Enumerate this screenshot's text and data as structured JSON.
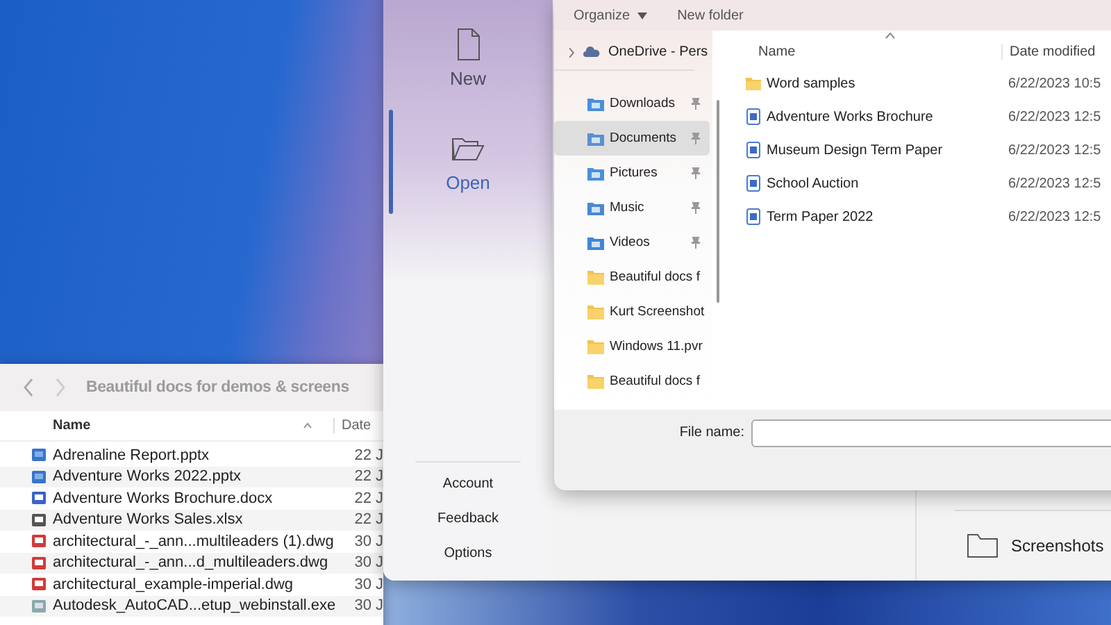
{
  "finder": {
    "path": "Beautiful docs for demos & screens",
    "columns": [
      "Name",
      "Date"
    ],
    "rows": [
      {
        "name": "Adrenaline Report.pptx",
        "date": "22 J",
        "kind": "slides"
      },
      {
        "name": "Adventure Works 2022.pptx",
        "date": "22 J",
        "kind": "slides"
      },
      {
        "name": "Adventure Works Brochure.docx",
        "date": "22 J",
        "kind": "doc"
      },
      {
        "name": "Adventure Works Sales.xlsx",
        "date": "22 J",
        "kind": "sheet"
      },
      {
        "name": "architectural_-_ann...multileaders (1).dwg",
        "date": "30 J",
        "kind": "dwg"
      },
      {
        "name": "architectural_-_ann...d_multileaders.dwg",
        "date": "30 J",
        "kind": "dwg"
      },
      {
        "name": "architectural_example-imperial.dwg",
        "date": "30 J",
        "kind": "dwg"
      },
      {
        "name": "Autodesk_AutoCAD...etup_webinstall.exe",
        "date": "30 J",
        "kind": "exe"
      }
    ]
  },
  "word": {
    "nav": [
      {
        "label": "New",
        "kind": "new",
        "selected": false
      },
      {
        "label": "Open",
        "kind": "open",
        "selected": true
      }
    ],
    "footer": [
      "Account",
      "Feedback",
      "Options"
    ],
    "recent_folder": "Screenshots"
  },
  "dialog": {
    "toolbar": [
      {
        "label": "Organize",
        "kind": "menu"
      },
      {
        "label": "New folder",
        "kind": "button"
      }
    ],
    "tree_root": "OneDrive - Pers",
    "quick_access": [
      {
        "label": "Downloads",
        "kind": "downloads",
        "pinned": true,
        "selected": false
      },
      {
        "label": "Documents",
        "kind": "documents",
        "pinned": true,
        "selected": true
      },
      {
        "label": "Pictures",
        "kind": "pictures",
        "pinned": true,
        "selected": false
      },
      {
        "label": "Music",
        "kind": "music",
        "pinned": true,
        "selected": false
      },
      {
        "label": "Videos",
        "kind": "videos",
        "pinned": true,
        "selected": false
      }
    ],
    "folders": [
      "Beautiful docs f",
      "Kurt Screenshot",
      "Windows 11.pvr",
      "Beautiful docs f"
    ],
    "columns": [
      "Name",
      "Date modified"
    ],
    "files": [
      {
        "name": "Word samples",
        "date": "6/22/2023 10:5",
        "kind": "folder"
      },
      {
        "name": "Adventure Works Brochure",
        "date": "6/22/2023 12:5",
        "kind": "doc"
      },
      {
        "name": "Museum Design Term Paper",
        "date": "6/22/2023 12:5",
        "kind": "doc"
      },
      {
        "name": "School Auction",
        "date": "6/22/2023 12:5",
        "kind": "doc"
      },
      {
        "name": "Term Paper 2022",
        "date": "6/22/2023 12:5",
        "kind": "doc"
      }
    ],
    "file_name_label": "File name:"
  }
}
